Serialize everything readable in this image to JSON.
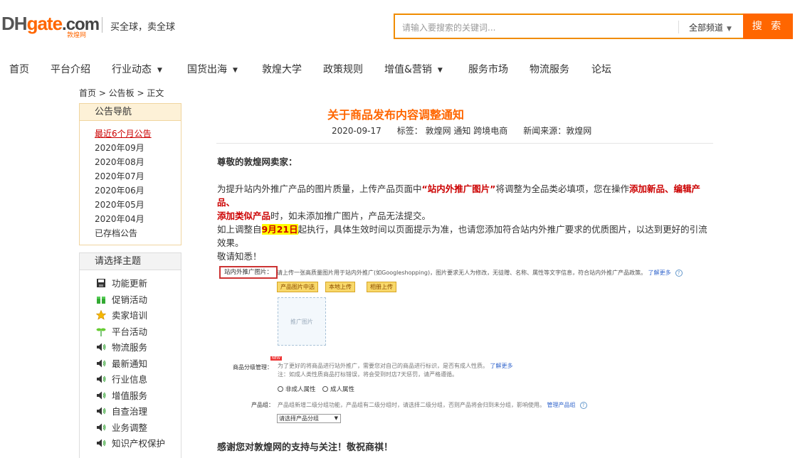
{
  "header": {
    "logo_dh": "DH",
    "logo_gate": "gate",
    "logo_com": ".com",
    "logo_sub": "敦煌网",
    "slogan": "买全球，卖全球",
    "search_placeholder": "请输入要搜索的关键词...",
    "search_scope": "全部频道",
    "search_button": "搜 索"
  },
  "nav": [
    {
      "label": "首页"
    },
    {
      "label": "平台介绍"
    },
    {
      "label": "行业动态"
    },
    {
      "label": "国货出海"
    },
    {
      "label": "敦煌大学"
    },
    {
      "label": "政策规则"
    },
    {
      "label": "增值&营销"
    },
    {
      "label": "服务市场"
    },
    {
      "label": "物流服务"
    },
    {
      "label": "论坛"
    }
  ],
  "breadcrumb": "首页 > 公告板 > 正文",
  "sidebar": {
    "notice_title": "公告导航",
    "months": [
      "最近6个月公告",
      "2020年09月",
      "2020年08月",
      "2020年07月",
      "2020年06月",
      "2020年05月",
      "2020年04月",
      "已存档公告"
    ],
    "topic_title": "请选择主题",
    "topics": [
      "功能更新",
      "促销活动",
      "卖家培训",
      "平台活动",
      "物流服务",
      "最新通知",
      "行业信息",
      "增值服务",
      "自查治理",
      "业务调整",
      "知识产权保护"
    ],
    "topic_icons": [
      "save-icon",
      "gift-icon",
      "star-icon",
      "sprout-icon",
      "speaker-icon",
      "speaker-icon",
      "speaker-icon",
      "speaker-icon",
      "speaker-icon",
      "speaker-icon",
      "speaker-icon"
    ]
  },
  "article": {
    "title": "关于商品发布内容调整通知",
    "date": "2020-09-17",
    "tags": "标签： 敦煌网  通知  跨境电商",
    "source": "新闻来源：敦煌网",
    "greeting": "尊敬的敦煌网卖家：",
    "p1_a": "为提升站内外推广产品的图片质量，上传产品页面中",
    "p1_red1": "“站内外推广图片”",
    "p1_b": "将调整为全品类必填项，您在操作",
    "p1_red2": "添加新品、编辑产品、",
    "p1_red3": "添加类似产品",
    "p1_c": "时，如未添加推广图片，产品无法提交。",
    "p2_a": "如上调整自",
    "p2_hl": "9月21日",
    "p2_b": "起执行，具体生效时间以页面提示为准，也请您添加符合站内外推广要求的优质图片，以达到更好的引流效果。",
    "p2_c": "敬请知悉！",
    "closing": "感谢您对敦煌网的支持与关注！敬祝商祺！"
  },
  "embedded": {
    "label": "站内外推广图片：",
    "desc": "请上传一张高质量图片用于站内外推广(如Googleshopping)，图片要求无人为修改，无徒赠、名称、属性等文字信息，符合站内外推广产品政策。",
    "desc_link": "了解更多",
    "help": "?",
    "btn1": "产品图片中选",
    "btn2": "本地上传",
    "btn3": "相册上传",
    "placeholder": "推广图片",
    "grade_label": "商品分级管理：",
    "new_tag": "NEW",
    "grade_line1": "为了更好的将商品进行站外推广，需要您对自己的商品进行标识，是否有成人性质。",
    "grade_link": "了解更多",
    "grade_line2": "注：如成人类性质商品打标错误，将会受到时店7天惩罚，请严格遵循。",
    "radio1": "非成人属性",
    "radio2": "成人属性",
    "group_label": "产品组：",
    "group_text": "产品组新增二级分组功能，产品组有二级分组时，请选择二级分组，否则产品将会归到未分组，影响使用。",
    "group_link": "管理产品组",
    "select": "请选择产品分组"
  }
}
